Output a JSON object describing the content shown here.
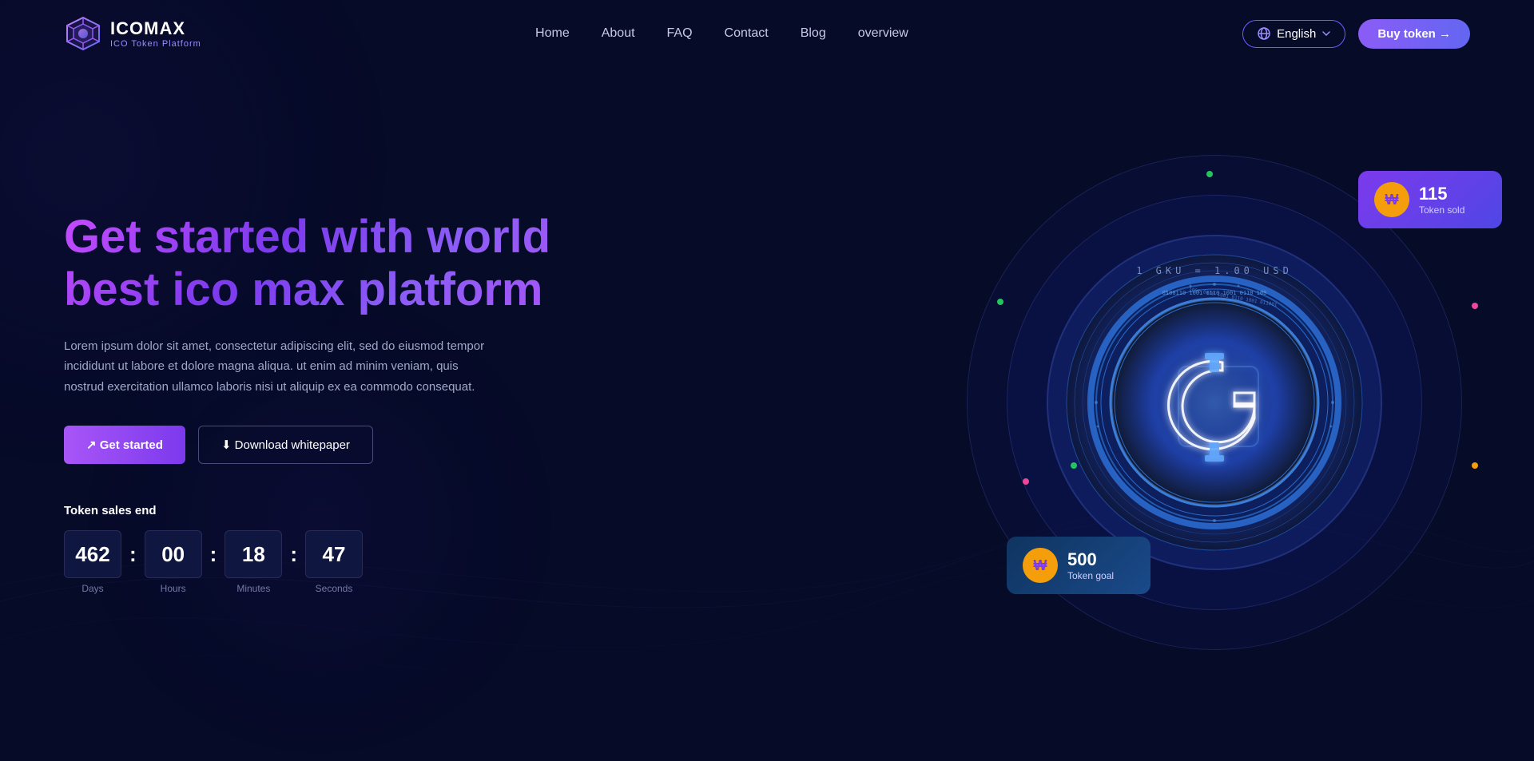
{
  "brand": {
    "name": "ICOMAX",
    "subtitle": "ICO Token Platform"
  },
  "nav": {
    "links": [
      {
        "label": "Home",
        "href": "#"
      },
      {
        "label": "About",
        "href": "#"
      },
      {
        "label": "FAQ",
        "href": "#"
      },
      {
        "label": "Contact",
        "href": "#"
      },
      {
        "label": "Blog",
        "href": "#"
      },
      {
        "label": "overview",
        "href": "#"
      }
    ],
    "language": "English",
    "buy_token": "Buy token →"
  },
  "hero": {
    "title": "Get started with world best ico max platform",
    "description": "Lorem ipsum dolor sit amet, consectetur adipiscing elit, sed do eiusmod tempor incididunt ut labore et dolore magna aliqua. ut enim ad minim veniam, quis nostrud exercitation ullamco laboris nisi ut aliquip ex ea commodo consequat.",
    "btn_primary": "↗ Get started",
    "btn_secondary": "⬇ Download whitepaper",
    "countdown_label": "Token sales end",
    "countdown": {
      "days": "462",
      "hours": "00",
      "minutes": "18",
      "seconds": "47",
      "days_label": "Days",
      "hours_label": "Hours",
      "minutes_label": "Minutes",
      "seconds_label": "Seconds"
    },
    "exchange_rate": "1 GKU = 1.00 USD",
    "card_top": {
      "number": "115",
      "text": "Token sold"
    },
    "card_bottom": {
      "number": "500",
      "text": "Token goal"
    }
  },
  "colors": {
    "primary": "#a855f7",
    "secondary": "#6366f1",
    "accent_yellow": "#f59e0b",
    "bg_dark": "#060b27",
    "bg_card": "#0f1640"
  }
}
